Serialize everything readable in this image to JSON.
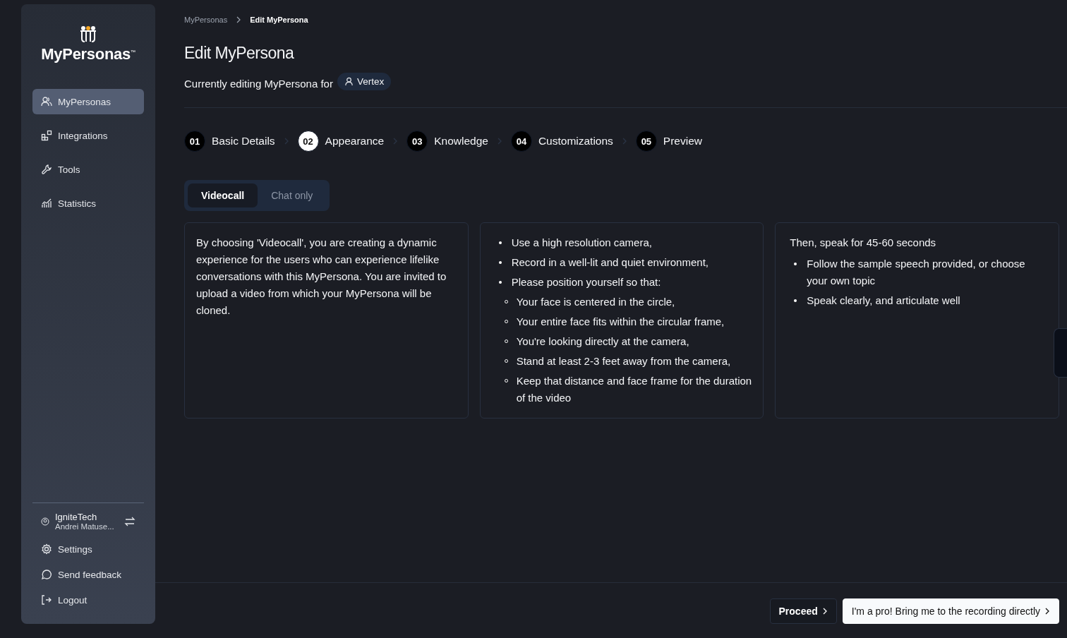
{
  "sidebar": {
    "logo": {
      "text": "MyPersonas",
      "mark": "™"
    },
    "items": [
      {
        "label": "MyPersonas",
        "kind": "users",
        "selected": true
      },
      {
        "label": "Integrations",
        "kind": "blocks",
        "selected": false
      },
      {
        "label": "Tools",
        "kind": "wrench",
        "selected": false
      },
      {
        "label": "Statistics",
        "kind": "chart",
        "selected": false
      }
    ],
    "account": {
      "org": "IgniteTech",
      "user": "Andrei Matuse..."
    },
    "bottom_items": [
      {
        "label": "Settings",
        "kind": "gear"
      },
      {
        "label": "Send feedback",
        "kind": "chat"
      },
      {
        "label": "Logout",
        "kind": "logout"
      }
    ]
  },
  "breadcrumb": [
    {
      "label": "MyPersonas",
      "selected": false
    },
    {
      "label": "Edit MyPersona",
      "selected": true
    }
  ],
  "title": "Edit MyPersona",
  "subtitle": {
    "text": "Currently editing MyPersona for",
    "persona": "Vertex"
  },
  "steps": [
    {
      "number": "01",
      "label": "Basic Details",
      "selected": false
    },
    {
      "number": "02",
      "label": "Appearance",
      "selected": true
    },
    {
      "number": "03",
      "label": "Knowledge",
      "selected": false
    },
    {
      "number": "04",
      "label": "Customizations",
      "selected": false
    },
    {
      "number": "05",
      "label": "Preview",
      "selected": false
    }
  ],
  "mode_tabs": [
    {
      "label": "Videocall",
      "selected": true
    },
    {
      "label": "Chat only",
      "selected": false
    }
  ],
  "cards": [
    {
      "kind": "text",
      "text": "By choosing 'Videocall', you are creating a dynamic experience for the users who can experience lifelike conversations with this MyPersona. You are invited to upload a video from which your MyPersona will be cloned."
    },
    {
      "kind": "list",
      "items": [
        {
          "text": "Use a high resolution camera,"
        },
        {
          "text": "Record in a well-lit and quiet environment,"
        },
        {
          "text": "Please position yourself so that:",
          "children": [
            {
              "text": "Your face is centered in the circle,"
            },
            {
              "text": "Your entire face fits within the circular frame,"
            },
            {
              "text": "You're looking directly at the camera,"
            },
            {
              "text": "Stand at least 2-3 feet away from the camera,"
            },
            {
              "text": "Keep that distance and face frame for the duration of the video"
            }
          ]
        }
      ]
    },
    {
      "kind": "list",
      "heading": "Then, speak for 45-60 seconds",
      "items": [
        {
          "text": "Follow the sample speech provided, or choose your own topic"
        },
        {
          "text": "Speak clearly, and articulate well"
        }
      ]
    }
  ],
  "footer": {
    "proceed": "Proceed",
    "direct": "I'm a pro! Bring me to the recording directly"
  }
}
